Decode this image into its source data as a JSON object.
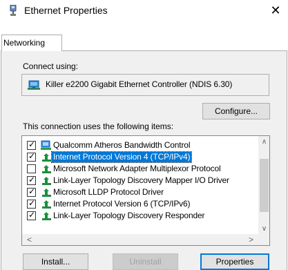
{
  "window": {
    "title": "Ethernet Properties",
    "close_glyph": "✕"
  },
  "tabs": [
    {
      "label": "Networking",
      "active": true
    }
  ],
  "connect_using": {
    "label": "Connect using:",
    "adapter_name": "Killer e2200 Gigabit Ethernet Controller (NDIS 6.30)",
    "adapter_icon": "network-adapter-icon"
  },
  "buttons": {
    "configure": "Configure...",
    "install": "Install...",
    "uninstall": "Uninstall",
    "properties": "Properties"
  },
  "items_label": "This connection uses the following items:",
  "items": [
    {
      "label": "Qualcomm Atheros Bandwidth Control",
      "checked": true,
      "icon": "qos-icon",
      "selected": false
    },
    {
      "label": "Internet Protocol Version 4 (TCP/IPv4)",
      "checked": true,
      "icon": "protocol-icon",
      "selected": true
    },
    {
      "label": "Microsoft Network Adapter Multiplexor Protocol",
      "checked": false,
      "icon": "protocol-icon",
      "selected": false
    },
    {
      "label": "Link-Layer Topology Discovery Mapper I/O Driver",
      "checked": true,
      "icon": "protocol-icon",
      "selected": false
    },
    {
      "label": "Microsoft LLDP Protocol Driver",
      "checked": true,
      "icon": "protocol-icon",
      "selected": false
    },
    {
      "label": "Internet Protocol Version 6 (TCP/IPv6)",
      "checked": true,
      "icon": "protocol-icon",
      "selected": false
    },
    {
      "label": "Link-Layer Topology Discovery Responder",
      "checked": true,
      "icon": "protocol-icon",
      "selected": false
    }
  ],
  "scroll": {
    "up": "∧",
    "down": "∨",
    "left": "<",
    "right": ">"
  },
  "colors": {
    "selection": "#0078d7",
    "panel": "#f0f0f0",
    "protocol_icon": "#1a8f3c"
  }
}
